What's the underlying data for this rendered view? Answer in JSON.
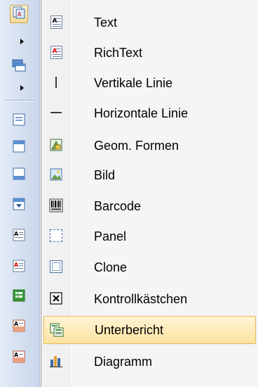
{
  "menu": {
    "items": [
      {
        "label": "Text",
        "icon": "text-box-icon",
        "highlighted": false
      },
      {
        "label": "RichText",
        "icon": "richtext-icon",
        "highlighted": false
      },
      {
        "label": "Vertikale Linie",
        "icon": "vertical-line-icon",
        "highlighted": false
      },
      {
        "label": "Horizontale Linie",
        "icon": "horizontal-line-icon",
        "highlighted": false
      },
      {
        "label": "Geom. Formen",
        "icon": "shapes-icon",
        "highlighted": false
      },
      {
        "label": "Bild",
        "icon": "picture-icon",
        "highlighted": false
      },
      {
        "label": "Barcode",
        "icon": "barcode-icon",
        "highlighted": false
      },
      {
        "label": "Panel",
        "icon": "panel-icon",
        "highlighted": false
      },
      {
        "label": "Clone",
        "icon": "clone-icon",
        "highlighted": false
      },
      {
        "label": "Kontrollkästchen",
        "icon": "checkbox-icon",
        "highlighted": false
      },
      {
        "label": "Unterbericht",
        "icon": "subreport-icon",
        "highlighted": true
      },
      {
        "label": "Diagramm",
        "icon": "chart-icon",
        "highlighted": false
      }
    ]
  },
  "toolbar": {
    "buttons": [
      "components-icon",
      "bands-icon",
      "page-header-icon",
      "header-band-icon",
      "footer-band-icon",
      "data-band-icon",
      "text-component-icon",
      "richtext-component-icon",
      "table-icon",
      "text-component-icon-2",
      "text-component-icon-3"
    ]
  },
  "colors": {
    "highlight_top": "#fff4d3",
    "highlight_bottom": "#fde3a2",
    "highlight_border": "#e6b85a",
    "toolbar_bg": "#d3deef"
  }
}
